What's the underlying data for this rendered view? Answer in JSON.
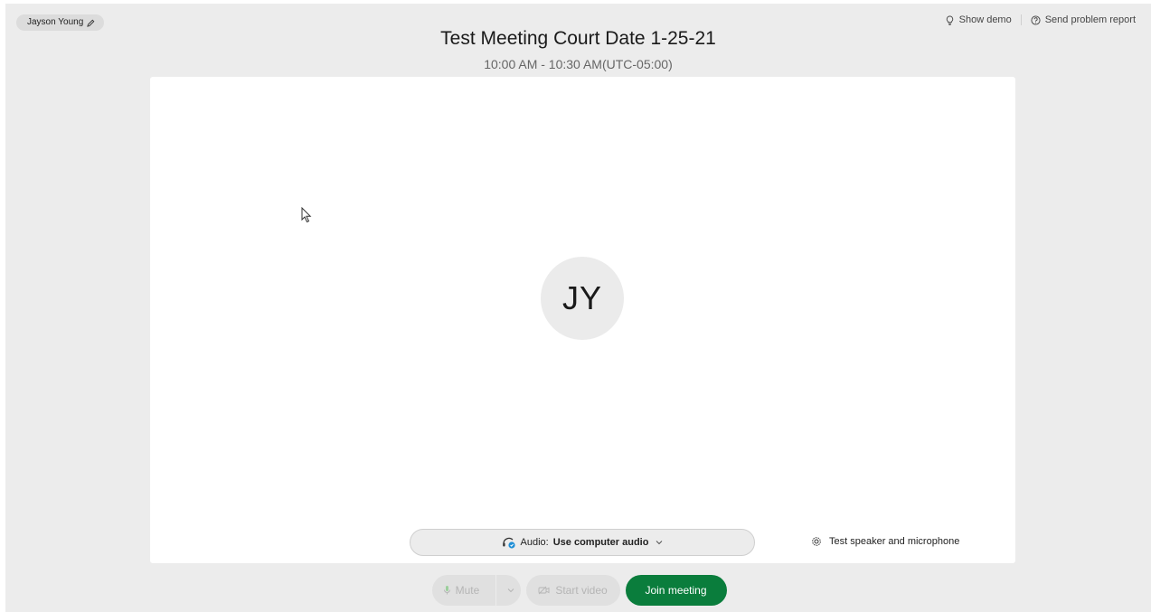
{
  "header": {
    "user_name": "Jayson Young",
    "show_demo": "Show demo",
    "send_problem_report": "Send problem report"
  },
  "meeting": {
    "title": "Test Meeting Court Date 1-25-21",
    "time": "10:00 AM - 10:30 AM(UTC-05:00)"
  },
  "preview": {
    "avatar_initials": "JY"
  },
  "audio": {
    "prefix": "Audio:",
    "value": "Use computer audio",
    "test_label": "Test speaker and microphone"
  },
  "controls": {
    "mute_label": "Mute",
    "start_video_label": "Start video",
    "join_label": "Join meeting"
  },
  "colors": {
    "join_button": "#0a7d3c",
    "background": "#ececec",
    "audio_icon_accent": "#1f8fd6"
  }
}
